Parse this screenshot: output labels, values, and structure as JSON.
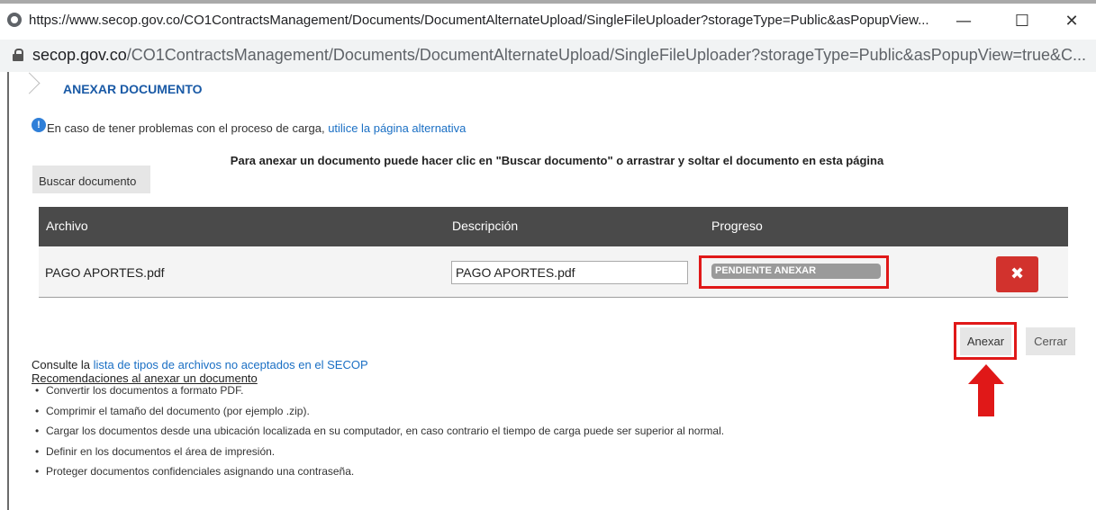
{
  "browser": {
    "title": "https://www.secop.gov.co/CO1ContractsManagement/Documents/DocumentAlternateUpload/SingleFileUploader?storageType=Public&asPopupView...",
    "minimize": "—",
    "maximize": "☐",
    "close": "✕",
    "url_host": "secop.gov.co",
    "url_path": "/CO1ContractsManagement/Documents/DocumentAlternateUpload/SingleFileUploader?storageType=Public&asPopupView=true&C..."
  },
  "page": {
    "section_title": "ANEXAR DOCUMENTO",
    "info_text": "En caso de tener problemas con el proceso de carga, ",
    "info_link": "utilice la página alternativa",
    "instructions": "Para anexar un documento puede hacer clic en \"Buscar documento\" o arrastrar y soltar el documento en esta página",
    "search_button": "Buscar documento"
  },
  "table": {
    "headers": {
      "file": "Archivo",
      "description": "Descripción",
      "progress": "Progreso"
    },
    "rows": [
      {
        "file": "PAGO APORTES.pdf",
        "description": "PAGO APORTES.pdf",
        "progress_label": "PENDIENTE ANEXAR",
        "progress": 0,
        "delete": "✖"
      }
    ]
  },
  "actions": {
    "attach": "Anexar",
    "close": "Cerrar"
  },
  "footer": {
    "consult_prefix": "Consulte la ",
    "consult_link": "lista de tipos de archivos no aceptados en el SECOP",
    "recommendations_title": "Recomendaciones al anexar un documento",
    "tips": [
      "Convertir los documentos a formato PDF.",
      "Comprimir el tamaño del documento (por ejemplo .zip).",
      "Cargar los documentos desde una ubicación localizada en su computador, en caso contrario el tiempo de carga puede ser superior al normal.",
      "Definir en los documentos el área de impresión.",
      "Proteger documentos confidenciales asignando una contraseña."
    ]
  },
  "colors": {
    "highlight": "#e01818",
    "link": "#1a6fc4",
    "title": "#1a5aa6",
    "table_header": "#4a4a4a",
    "delete_button": "#d2322d"
  }
}
